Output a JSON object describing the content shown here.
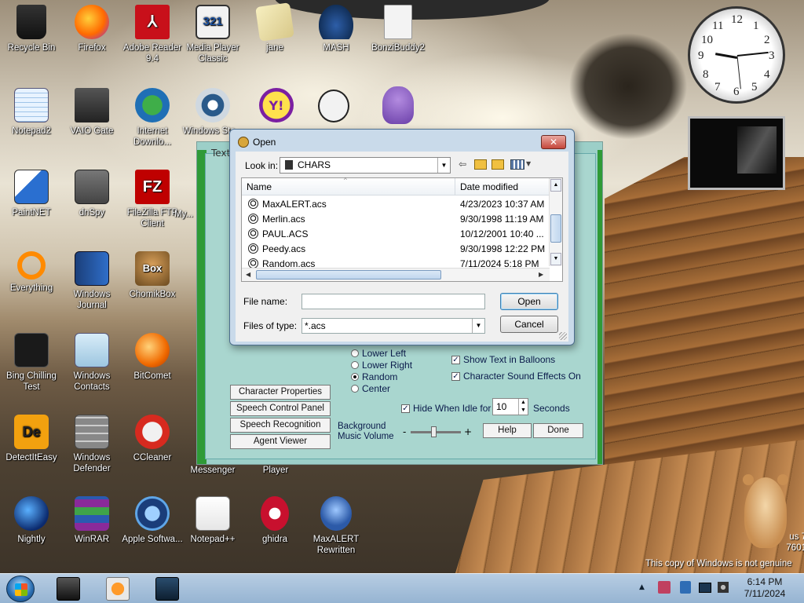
{
  "desktop": {
    "icons": [
      {
        "label": "Recycle Bin"
      },
      {
        "label": "Firefox"
      },
      {
        "label": "Adobe Reader 9.4"
      },
      {
        "label": "Media Player Classic"
      },
      {
        "label": "jane"
      },
      {
        "label": "MASH"
      },
      {
        "label": "BonziBuddy2"
      },
      {
        "label": "Notepad2"
      },
      {
        "label": "VAIO Gate"
      },
      {
        "label": "Internet Downlo..."
      },
      {
        "label": "Windows Ste..."
      },
      {
        "label": "PaintNET"
      },
      {
        "label": "dnSpy"
      },
      {
        "label": "FileZilla FTP Client"
      },
      {
        "label": "My..."
      },
      {
        "label": "Everything"
      },
      {
        "label": "Windows Journal"
      },
      {
        "label": "ChomikBox"
      },
      {
        "label": "Bing Chilling Test"
      },
      {
        "label": "Windows Contacts"
      },
      {
        "label": "BitComet"
      },
      {
        "label": "DetectItEasy"
      },
      {
        "label": "Windows Defender"
      },
      {
        "label": "CCleaner"
      },
      {
        "label": "Win... Messenger"
      },
      {
        "label": "Player"
      },
      {
        "label": "Nightly"
      },
      {
        "label": "WinRAR"
      },
      {
        "label": "Apple Softwa..."
      },
      {
        "label": "Notepad++"
      },
      {
        "label": "ghidra"
      },
      {
        "label": "MaxALERT Rewritten"
      }
    ],
    "icon_glyphs": {
      "mpc": "321",
      "filezilla": "FZ",
      "yahoo": "Y!",
      "detect": "De",
      "chomik": "Box"
    },
    "watermark_line1": "us 7",
    "watermark_line2": "7601",
    "watermark_line3": "This copy of Windows is not genuine"
  },
  "clock_gadget": {
    "numbers": [
      "12",
      "1",
      "2",
      "3",
      "4",
      "5",
      "6",
      "7",
      "8",
      "9",
      "10",
      "11"
    ]
  },
  "agent_window": {
    "tab_label": "Text",
    "buttons": {
      "character_properties": "Character Properties",
      "speech_control_panel": "Speech Control Panel",
      "speech_recognition": "Speech Recognition",
      "agent_viewer": "Agent Viewer",
      "help": "Help",
      "done": "Done"
    },
    "position_options": [
      "Lower Left",
      "Lower Right",
      "Random",
      "Center"
    ],
    "selected_position": "Random",
    "show_text_in_balloons": "Show Text in Balloons",
    "character_sound_effects": "Character Sound Effects On",
    "hide_when_idle_for": "Hide When Idle for",
    "idle_value": "10",
    "seconds": "Seconds",
    "background_music_volume": "Background Music Volume",
    "slider_minus": "-",
    "slider_plus": "+",
    "volume_level": 0.45
  },
  "open_dialog": {
    "title": "Open",
    "close_label": "✕",
    "look_in_label": "Look in:",
    "look_in_value": "CHARS",
    "columns": {
      "name": "Name",
      "date": "Date modified"
    },
    "files": [
      {
        "name": "MaxALERT.acs",
        "date": "4/23/2023 10:37 AM"
      },
      {
        "name": "Merlin.acs",
        "date": "9/30/1998 11:19 AM"
      },
      {
        "name": "PAUL.ACS",
        "date": "10/12/2001 10:40 ..."
      },
      {
        "name": "Peedy.acs",
        "date": "9/30/1998 12:22 PM"
      },
      {
        "name": "Random.acs",
        "date": "7/11/2024 5:18 PM"
      }
    ],
    "file_name_label": "File name:",
    "file_name_value": "",
    "files_of_type_label": "Files of type:",
    "files_of_type_value": "*.acs",
    "open_button": "Open",
    "cancel_button": "Cancel"
  },
  "taskbar": {
    "time": "6:14 PM",
    "date": "7/11/2024",
    "tray_up": "▲"
  },
  "colors": {
    "dialog_frame": "#c9daea",
    "agent_bg": "#9ccfc8",
    "agent_frame_green": "#2f9a37",
    "taskbar": "#a9c2dc",
    "close_red": "#c5473b"
  }
}
